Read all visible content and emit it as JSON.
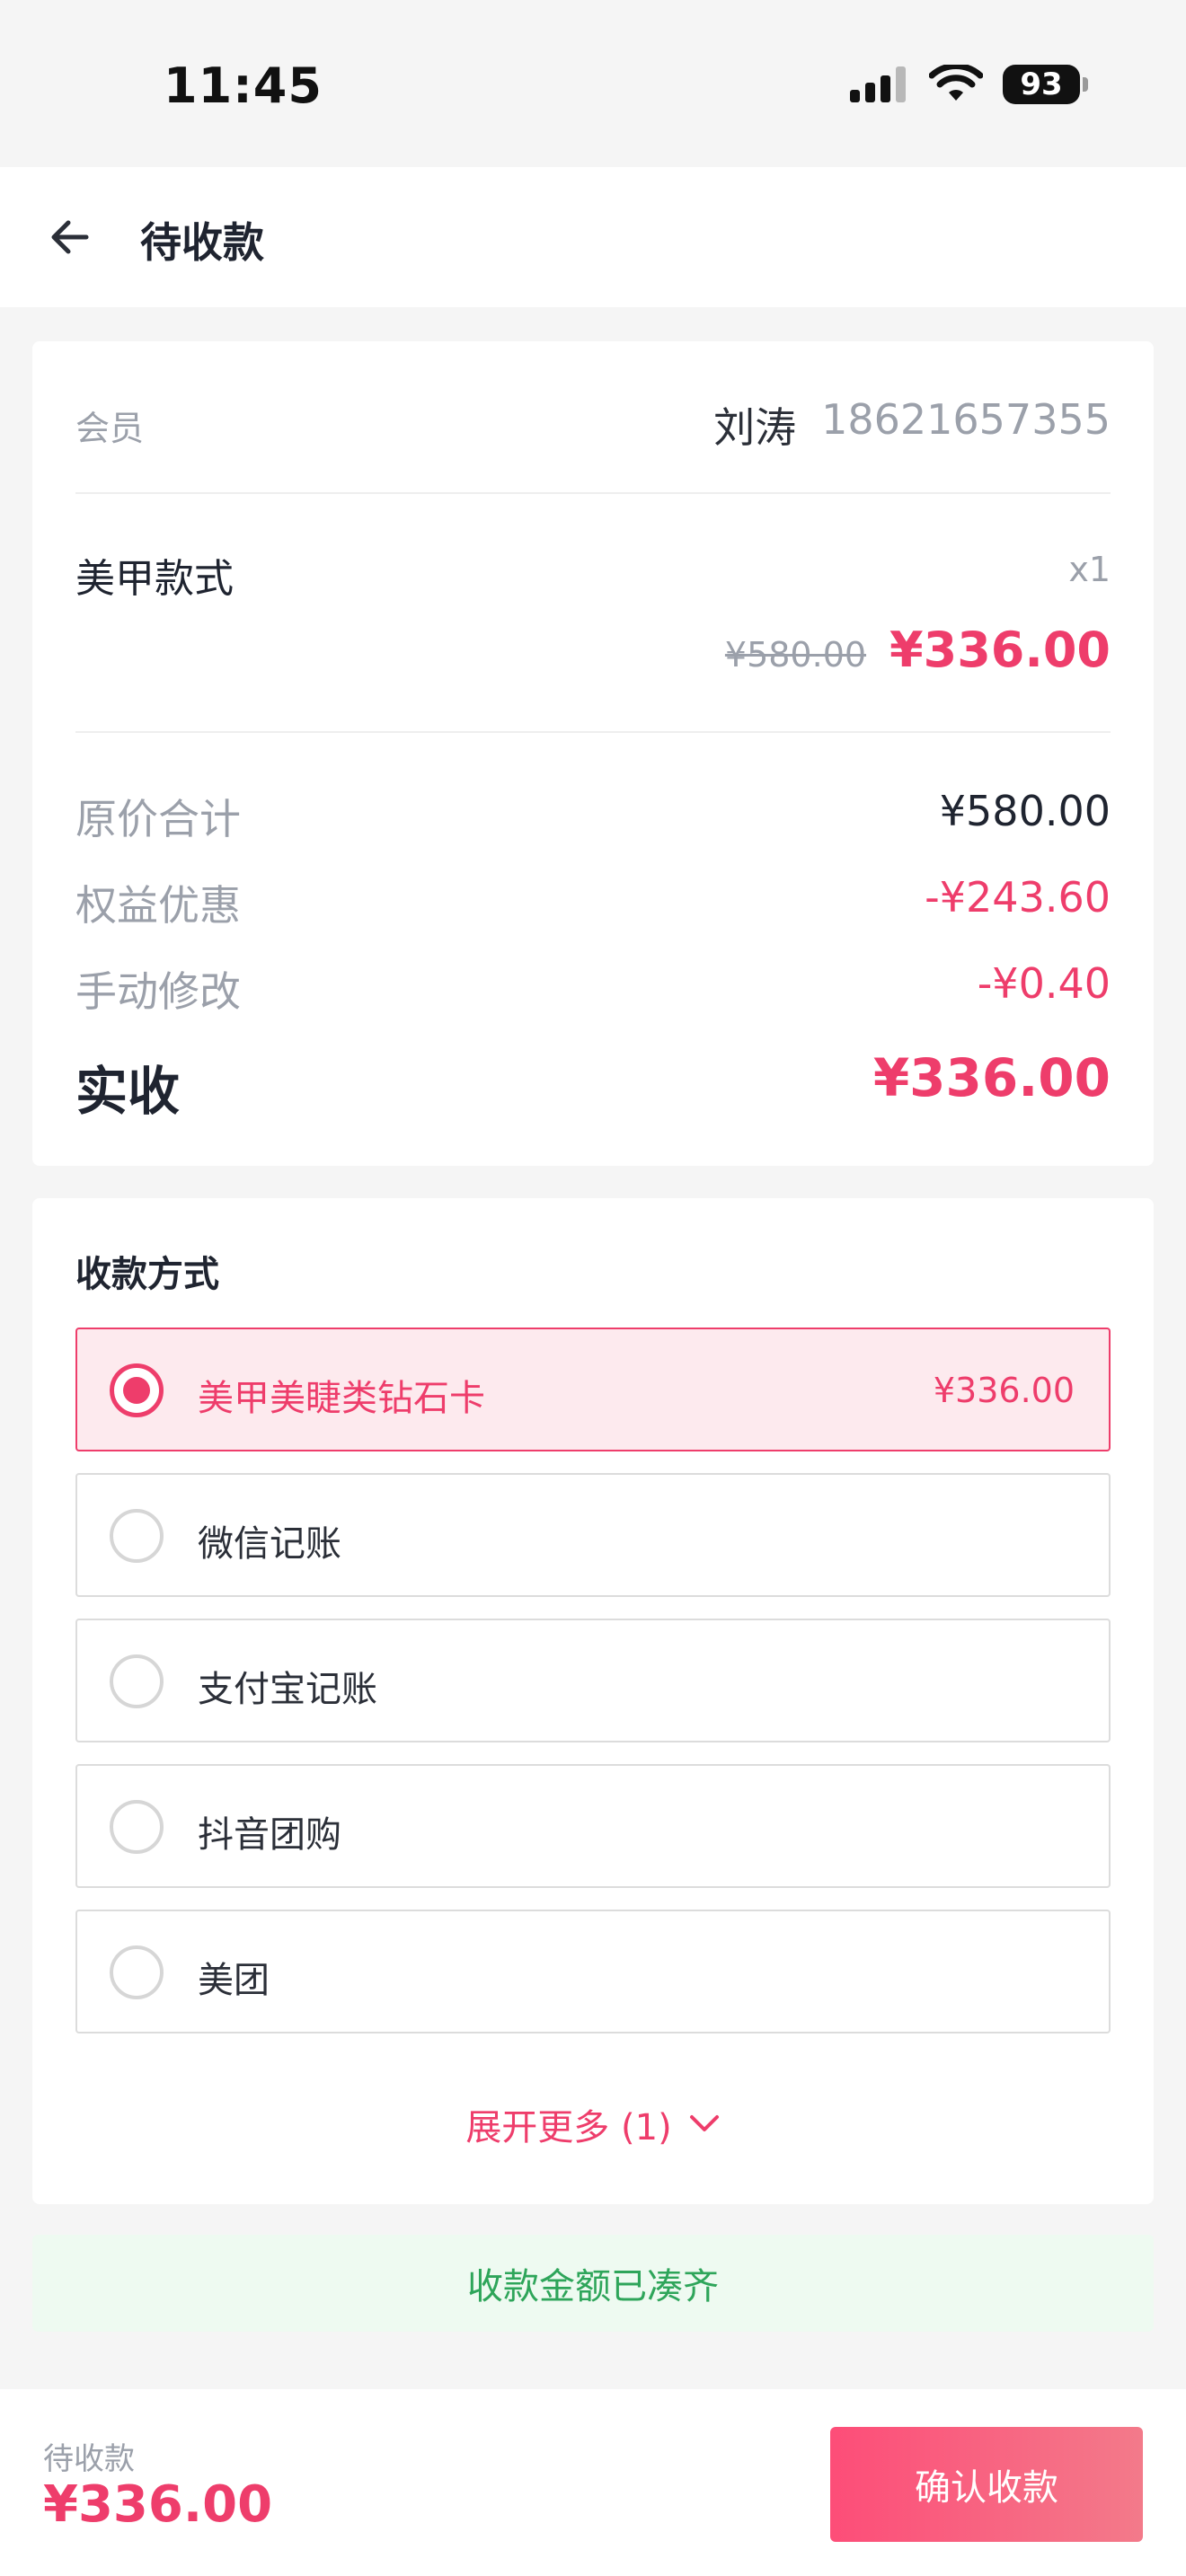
{
  "status_bar": {
    "time": "11:45",
    "battery": "93"
  },
  "header": {
    "title": "待收款"
  },
  "member": {
    "label": "会员",
    "name": "刘涛",
    "phone": "18621657355"
  },
  "item": {
    "name": "美甲款式",
    "qty": "x1",
    "original_price": "¥580.00",
    "price": "¥336.00"
  },
  "summary": {
    "rows": [
      {
        "label": "原价合计",
        "value": "¥580.00"
      },
      {
        "label": "权益优惠",
        "value": "-¥243.60"
      },
      {
        "label": "手动修改",
        "value": "-¥0.40"
      }
    ],
    "total_label": "实收",
    "total_value": "¥336.00"
  },
  "payment": {
    "title": "收款方式",
    "options": [
      {
        "label": "美甲美睫类钻石卡",
        "amount": "¥336.00",
        "selected": true
      },
      {
        "label": "微信记账",
        "amount": "",
        "selected": false
      },
      {
        "label": "支付宝记账",
        "amount": "",
        "selected": false
      },
      {
        "label": "抖音团购",
        "amount": "",
        "selected": false
      },
      {
        "label": "美团",
        "amount": "",
        "selected": false
      }
    ],
    "expand_label": "展开更多 (1)"
  },
  "notice": "收款金额已凑齐",
  "footer": {
    "label": "待收款",
    "amount": "¥336.00",
    "confirm_label": "确认收款"
  },
  "colors": {
    "accent": "#ee3d6b",
    "success": "#2ea55a"
  }
}
